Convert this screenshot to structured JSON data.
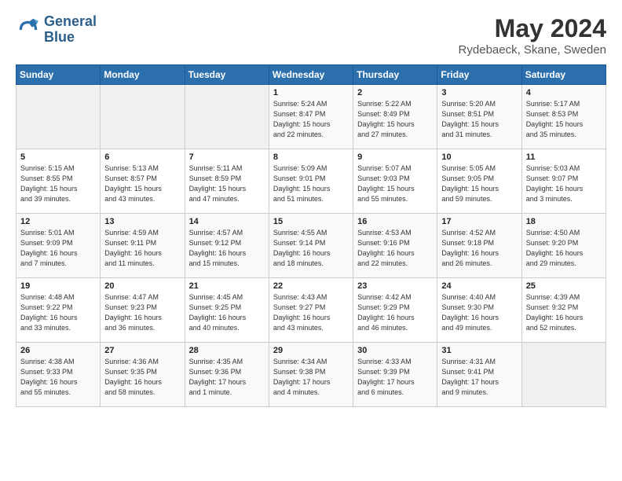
{
  "header": {
    "logo_line1": "General",
    "logo_line2": "Blue",
    "month": "May 2024",
    "location": "Rydebaeck, Skane, Sweden"
  },
  "days_of_week": [
    "Sunday",
    "Monday",
    "Tuesday",
    "Wednesday",
    "Thursday",
    "Friday",
    "Saturday"
  ],
  "weeks": [
    [
      {
        "day": "",
        "info": ""
      },
      {
        "day": "",
        "info": ""
      },
      {
        "day": "",
        "info": ""
      },
      {
        "day": "1",
        "info": "Sunrise: 5:24 AM\nSunset: 8:47 PM\nDaylight: 15 hours\nand 22 minutes."
      },
      {
        "day": "2",
        "info": "Sunrise: 5:22 AM\nSunset: 8:49 PM\nDaylight: 15 hours\nand 27 minutes."
      },
      {
        "day": "3",
        "info": "Sunrise: 5:20 AM\nSunset: 8:51 PM\nDaylight: 15 hours\nand 31 minutes."
      },
      {
        "day": "4",
        "info": "Sunrise: 5:17 AM\nSunset: 8:53 PM\nDaylight: 15 hours\nand 35 minutes."
      }
    ],
    [
      {
        "day": "5",
        "info": "Sunrise: 5:15 AM\nSunset: 8:55 PM\nDaylight: 15 hours\nand 39 minutes."
      },
      {
        "day": "6",
        "info": "Sunrise: 5:13 AM\nSunset: 8:57 PM\nDaylight: 15 hours\nand 43 minutes."
      },
      {
        "day": "7",
        "info": "Sunrise: 5:11 AM\nSunset: 8:59 PM\nDaylight: 15 hours\nand 47 minutes."
      },
      {
        "day": "8",
        "info": "Sunrise: 5:09 AM\nSunset: 9:01 PM\nDaylight: 15 hours\nand 51 minutes."
      },
      {
        "day": "9",
        "info": "Sunrise: 5:07 AM\nSunset: 9:03 PM\nDaylight: 15 hours\nand 55 minutes."
      },
      {
        "day": "10",
        "info": "Sunrise: 5:05 AM\nSunset: 9:05 PM\nDaylight: 15 hours\nand 59 minutes."
      },
      {
        "day": "11",
        "info": "Sunrise: 5:03 AM\nSunset: 9:07 PM\nDaylight: 16 hours\nand 3 minutes."
      }
    ],
    [
      {
        "day": "12",
        "info": "Sunrise: 5:01 AM\nSunset: 9:09 PM\nDaylight: 16 hours\nand 7 minutes."
      },
      {
        "day": "13",
        "info": "Sunrise: 4:59 AM\nSunset: 9:11 PM\nDaylight: 16 hours\nand 11 minutes."
      },
      {
        "day": "14",
        "info": "Sunrise: 4:57 AM\nSunset: 9:12 PM\nDaylight: 16 hours\nand 15 minutes."
      },
      {
        "day": "15",
        "info": "Sunrise: 4:55 AM\nSunset: 9:14 PM\nDaylight: 16 hours\nand 18 minutes."
      },
      {
        "day": "16",
        "info": "Sunrise: 4:53 AM\nSunset: 9:16 PM\nDaylight: 16 hours\nand 22 minutes."
      },
      {
        "day": "17",
        "info": "Sunrise: 4:52 AM\nSunset: 9:18 PM\nDaylight: 16 hours\nand 26 minutes."
      },
      {
        "day": "18",
        "info": "Sunrise: 4:50 AM\nSunset: 9:20 PM\nDaylight: 16 hours\nand 29 minutes."
      }
    ],
    [
      {
        "day": "19",
        "info": "Sunrise: 4:48 AM\nSunset: 9:22 PM\nDaylight: 16 hours\nand 33 minutes."
      },
      {
        "day": "20",
        "info": "Sunrise: 4:47 AM\nSunset: 9:23 PM\nDaylight: 16 hours\nand 36 minutes."
      },
      {
        "day": "21",
        "info": "Sunrise: 4:45 AM\nSunset: 9:25 PM\nDaylight: 16 hours\nand 40 minutes."
      },
      {
        "day": "22",
        "info": "Sunrise: 4:43 AM\nSunset: 9:27 PM\nDaylight: 16 hours\nand 43 minutes."
      },
      {
        "day": "23",
        "info": "Sunrise: 4:42 AM\nSunset: 9:29 PM\nDaylight: 16 hours\nand 46 minutes."
      },
      {
        "day": "24",
        "info": "Sunrise: 4:40 AM\nSunset: 9:30 PM\nDaylight: 16 hours\nand 49 minutes."
      },
      {
        "day": "25",
        "info": "Sunrise: 4:39 AM\nSunset: 9:32 PM\nDaylight: 16 hours\nand 52 minutes."
      }
    ],
    [
      {
        "day": "26",
        "info": "Sunrise: 4:38 AM\nSunset: 9:33 PM\nDaylight: 16 hours\nand 55 minutes."
      },
      {
        "day": "27",
        "info": "Sunrise: 4:36 AM\nSunset: 9:35 PM\nDaylight: 16 hours\nand 58 minutes."
      },
      {
        "day": "28",
        "info": "Sunrise: 4:35 AM\nSunset: 9:36 PM\nDaylight: 17 hours\nand 1 minute."
      },
      {
        "day": "29",
        "info": "Sunrise: 4:34 AM\nSunset: 9:38 PM\nDaylight: 17 hours\nand 4 minutes."
      },
      {
        "day": "30",
        "info": "Sunrise: 4:33 AM\nSunset: 9:39 PM\nDaylight: 17 hours\nand 6 minutes."
      },
      {
        "day": "31",
        "info": "Sunrise: 4:31 AM\nSunset: 9:41 PM\nDaylight: 17 hours\nand 9 minutes."
      },
      {
        "day": "",
        "info": ""
      }
    ]
  ]
}
